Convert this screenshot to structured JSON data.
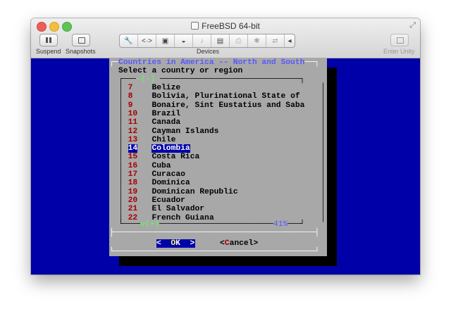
{
  "window": {
    "title": "FreeBSD 64-bit"
  },
  "toolbar": {
    "suspend_label": "Suspend",
    "snapshots_label": "Snapshots",
    "devices_label": "Devices",
    "unity_label": "Enter Unity"
  },
  "dialog": {
    "title": "Countries in America -- North and South",
    "prompt": "Select a country or region",
    "scroll_percent": "41%",
    "more_above": "-(-)-",
    "more_below": "v(+)",
    "items": [
      {
        "num": "7",
        "name": "Belize"
      },
      {
        "num": "8",
        "name": "Bolivia, Plurinational State of"
      },
      {
        "num": "9",
        "name": "Bonaire, Sint Eustatius and Saba"
      },
      {
        "num": "10",
        "name": "Brazil"
      },
      {
        "num": "11",
        "name": "Canada"
      },
      {
        "num": "12",
        "name": "Cayman Islands"
      },
      {
        "num": "13",
        "name": "Chile"
      },
      {
        "num": "14",
        "name": "Colombia",
        "selected": true
      },
      {
        "num": "15",
        "name": "Costa Rica"
      },
      {
        "num": "16",
        "name": "Cuba"
      },
      {
        "num": "17",
        "name": "Curacao"
      },
      {
        "num": "18",
        "name": "Dominica"
      },
      {
        "num": "19",
        "name": "Dominican Republic"
      },
      {
        "num": "20",
        "name": "Ecuador"
      },
      {
        "num": "21",
        "name": "El Salvador"
      },
      {
        "num": "22",
        "name": "French Guiana"
      }
    ],
    "ok_button": {
      "left": "<",
      "hot": "O",
      "rest": "K",
      "right": ">"
    },
    "cancel_button": {
      "left": "<",
      "hot": "C",
      "rest": "ancel",
      "right": ">"
    }
  },
  "colors": {
    "screen": "#0000a8",
    "dialog": "#a8a8a8",
    "highlight": "#0000a8"
  }
}
